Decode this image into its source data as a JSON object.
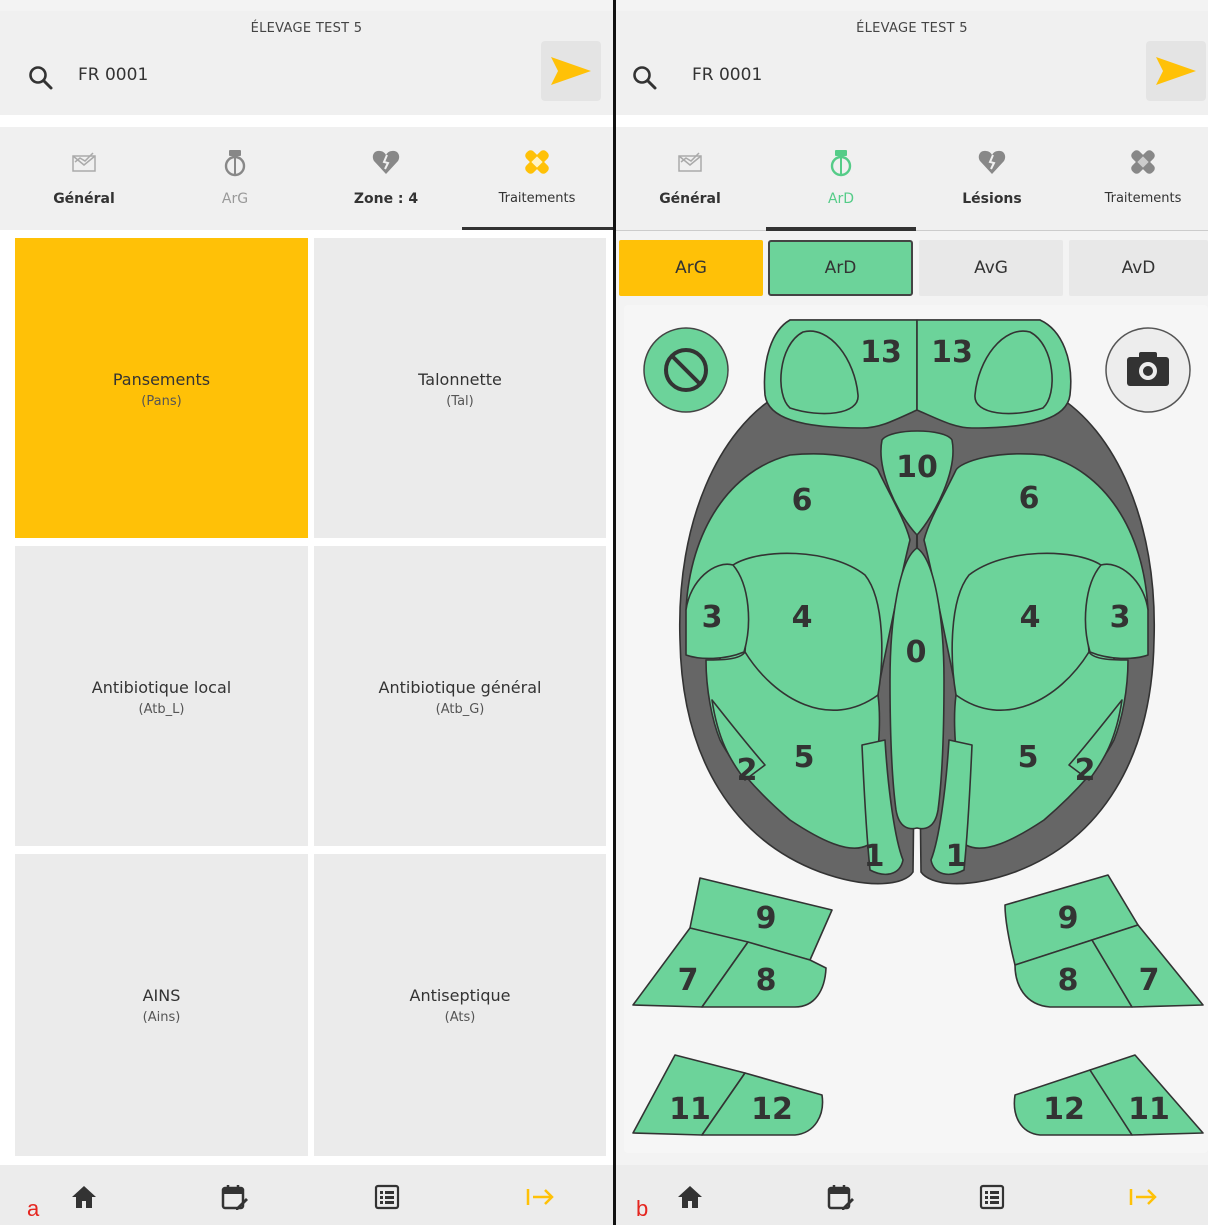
{
  "panel_a": {
    "label": "a",
    "farm_name": "ÉLEVAGE TEST 5",
    "animal_id": "FR 0001",
    "tabs": [
      {
        "label": "Général",
        "icon": "chart-envelope-icon"
      },
      {
        "label": "ArG",
        "icon": "hoof-icon"
      },
      {
        "label": "Zone : 4",
        "icon": "broken-heart-icon"
      },
      {
        "label": "Traitements",
        "icon": "bandage-icon",
        "active": true
      }
    ],
    "treatments": [
      {
        "name": "Pansements",
        "code": "(Pans)",
        "selected": true
      },
      {
        "name": "Talonnette",
        "code": "(Tal)"
      },
      {
        "name": "Antibiotique local",
        "code": "(Atb_L)"
      },
      {
        "name": "Antibiotique général",
        "code": "(Atb_G)"
      },
      {
        "name": "AINS",
        "code": "(Ains)"
      },
      {
        "name": "Antiseptique",
        "code": "(Ats)"
      }
    ]
  },
  "panel_b": {
    "label": "b",
    "farm_name": "ÉLEVAGE TEST 5",
    "animal_id": "FR 0001",
    "tabs": [
      {
        "label": "Général",
        "icon": "chart-envelope-icon"
      },
      {
        "label": "ArD",
        "icon": "hoof-icon",
        "active": true
      },
      {
        "label": "Lésions",
        "icon": "broken-heart-icon"
      },
      {
        "label": "Traitements",
        "icon": "bandage-icon"
      }
    ],
    "feet": [
      {
        "label": "ArG",
        "state": "yellow"
      },
      {
        "label": "ArD",
        "state": "green-selected"
      },
      {
        "label": "AvG",
        "state": "none"
      },
      {
        "label": "AvD",
        "state": "none"
      }
    ],
    "zones": [
      "13",
      "13",
      "10",
      "6",
      "6",
      "3",
      "4",
      "0",
      "4",
      "3",
      "5",
      "5",
      "2",
      "2",
      "1",
      "1",
      "9",
      "9",
      "7",
      "8",
      "8",
      "7",
      "11",
      "12",
      "12",
      "11"
    ]
  },
  "bottom_nav": [
    "home-icon",
    "calendar-edit-icon",
    "list-icon",
    "logout-icon"
  ],
  "colors": {
    "accent": "#FFC107",
    "zone_green": "#6CD39A",
    "hoof_outline": "#555555"
  }
}
